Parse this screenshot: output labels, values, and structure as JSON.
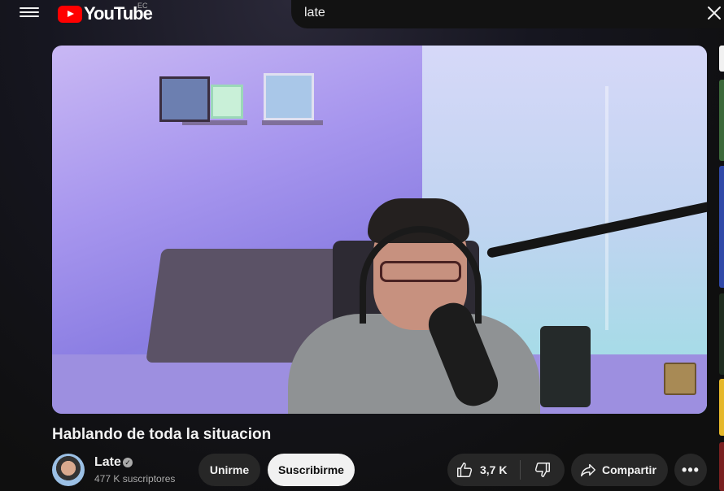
{
  "header": {
    "logo_text": "YouTube",
    "country_code": "EC",
    "search_value": "late"
  },
  "video": {
    "title": "Hablando de toda la situacion"
  },
  "channel": {
    "name": "Late",
    "subscribers": "477 K suscriptores"
  },
  "actions": {
    "join_label": "Unirme",
    "subscribe_label": "Suscribirme",
    "like_count": "3,7 K",
    "share_label": "Compartir",
    "more_label": "•••"
  },
  "icons": {
    "menu": "hamburger-menu-icon",
    "close": "close-icon",
    "verified": "verified-check-icon",
    "like": "thumbs-up-icon",
    "dislike": "thumbs-down-icon",
    "share": "share-arrow-icon",
    "more": "more-horizontal-icon"
  },
  "colors": {
    "background": "#0f0f0f",
    "brand_red": "#ff0000",
    "pill": "#272727",
    "subscribe_bg": "#f1f1f1"
  }
}
